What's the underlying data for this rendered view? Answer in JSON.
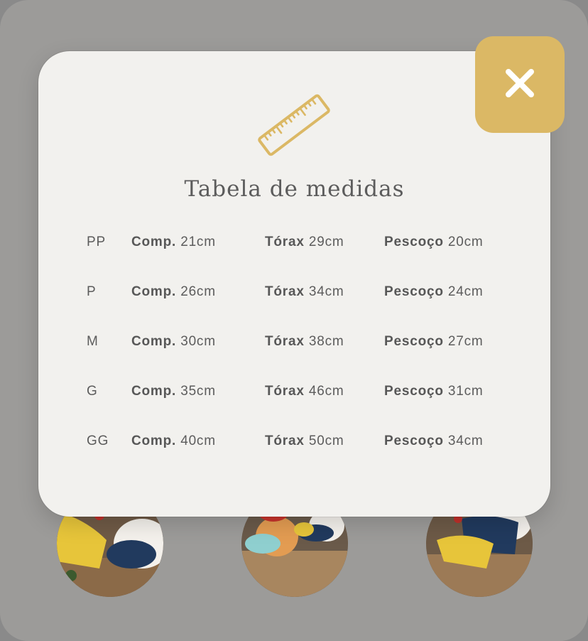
{
  "modal": {
    "title": "Tabela de medidas",
    "icon": "ruler-icon",
    "close_icon": "close-icon",
    "accent_color": "#dbb865"
  },
  "table": {
    "rows": [
      {
        "size": "PP",
        "comp_label": "Comp.",
        "comp_value": "21cm",
        "torax_label": "Tórax",
        "torax_value": "29cm",
        "pescoco_label": "Pescoço",
        "pescoco_value": "20cm"
      },
      {
        "size": "P",
        "comp_label": "Comp.",
        "comp_value": "26cm",
        "torax_label": "Tórax",
        "torax_value": "34cm",
        "pescoco_label": "Pescoço",
        "pescoco_value": "24cm"
      },
      {
        "size": "M",
        "comp_label": "Comp.",
        "comp_value": "30cm",
        "torax_label": "Tórax",
        "torax_value": "38cm",
        "pescoco_label": "Pescoço",
        "pescoco_value": "27cm"
      },
      {
        "size": "G",
        "comp_label": "Comp.",
        "comp_value": "35cm",
        "torax_label": "Tórax",
        "torax_value": "46cm",
        "pescoco_label": "Pescoço",
        "pescoco_value": "31cm"
      },
      {
        "size": "GG",
        "comp_label": "Comp.",
        "comp_value": "40cm",
        "torax_label": "Tórax",
        "torax_value": "50cm",
        "pescoco_label": "Pescoço",
        "pescoco_value": "34cm"
      }
    ]
  }
}
